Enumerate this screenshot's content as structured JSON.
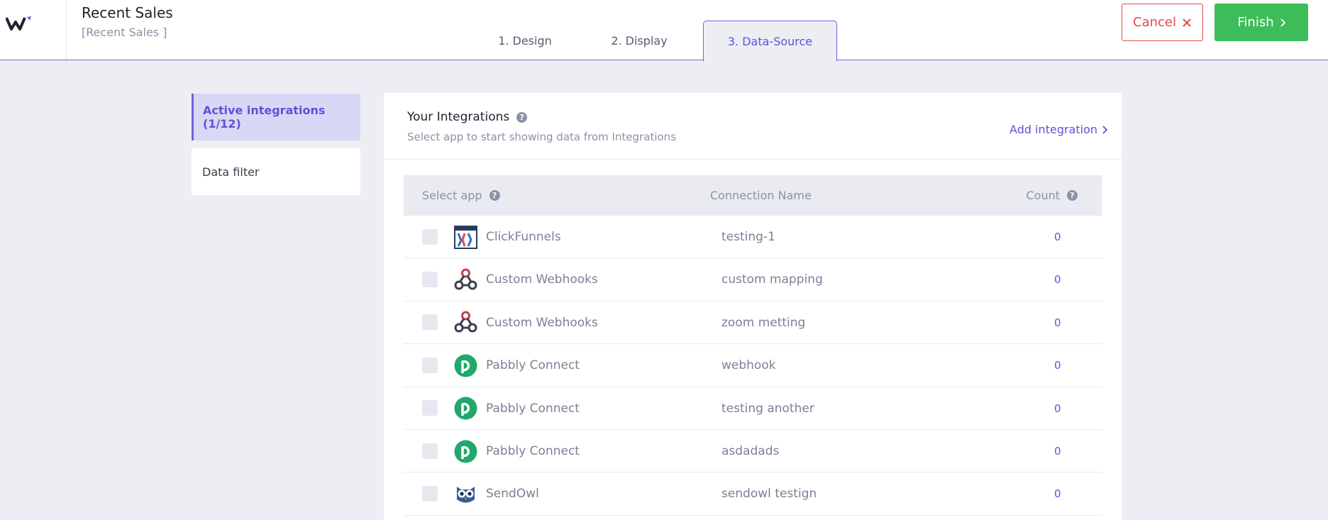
{
  "header": {
    "title": "Recent Sales",
    "subtitle": "[Recent Sales ]",
    "tabs": [
      {
        "label": "1. Design"
      },
      {
        "label": "2. Display"
      },
      {
        "label": "3. Data-Source"
      }
    ],
    "cancel_label": "Cancel",
    "finish_label": "Finish"
  },
  "sidebar": {
    "items": [
      {
        "label": "Active integrations (1/12)"
      },
      {
        "label": "Data filter"
      }
    ]
  },
  "panel": {
    "title": "Your Integrations",
    "subtitle": "Select app to start showing data from Integrations",
    "add_label": "Add integration"
  },
  "table": {
    "headers": {
      "app": "Select app",
      "connection": "Connection Name",
      "count": "Count"
    },
    "rows": [
      {
        "app": "ClickFunnels",
        "icon": "clickfunnels-icon",
        "connection": "testing-1",
        "count": "0"
      },
      {
        "app": "Custom Webhooks",
        "icon": "webhook-icon",
        "connection": "custom mapping",
        "count": "0"
      },
      {
        "app": "Custom Webhooks",
        "icon": "webhook-icon",
        "connection": "zoom metting",
        "count": "0"
      },
      {
        "app": "Pabbly Connect",
        "icon": "pabbly-icon",
        "connection": "webhook",
        "count": "0"
      },
      {
        "app": "Pabbly Connect",
        "icon": "pabbly-icon",
        "connection": "testing another",
        "count": "0"
      },
      {
        "app": "Pabbly Connect",
        "icon": "pabbly-icon",
        "connection": "asdadads",
        "count": "0"
      },
      {
        "app": "SendOwl",
        "icon": "sendowl-icon",
        "connection": "sendowl testign",
        "count": "0"
      }
    ]
  },
  "colors": {
    "accent": "#5b54d6",
    "success": "#3dbd5a",
    "danger": "#e04b4b"
  }
}
